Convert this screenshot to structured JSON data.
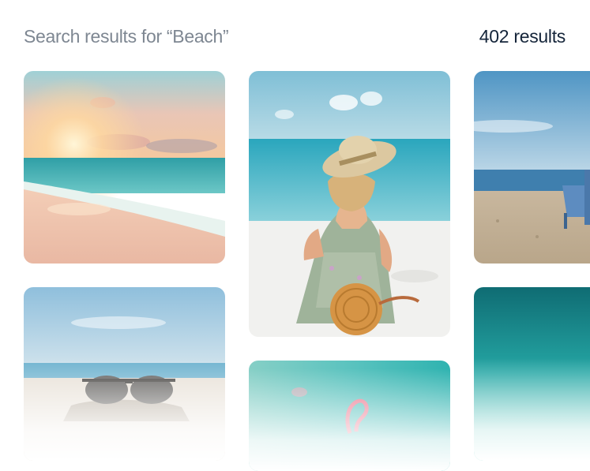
{
  "search": {
    "heading": "Search results for “Beach”",
    "count_label": "402 results"
  },
  "results": [
    {
      "subject": "sunset over ocean waves"
    },
    {
      "subject": "woman in sun hat sitting on beach"
    },
    {
      "subject": "blue beach chair on sand"
    },
    {
      "subject": "sunglasses on sand"
    },
    {
      "subject": "flamingo in turquoise water"
    },
    {
      "subject": "turquoise sea water"
    }
  ]
}
